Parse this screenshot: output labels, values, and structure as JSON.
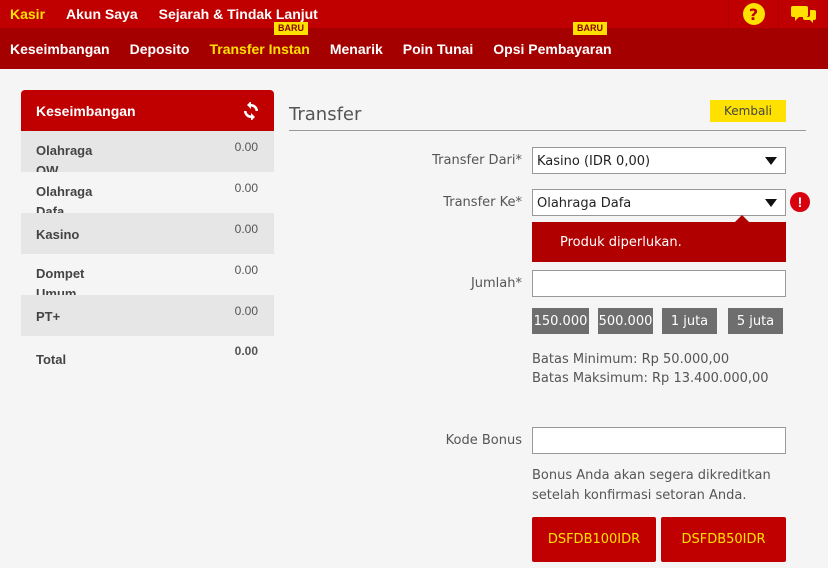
{
  "top_nav": [
    {
      "label": "Kasir",
      "active": true
    },
    {
      "label": "Akun Saya",
      "active": false
    },
    {
      "label": "Sejarah & Tindak Lanjut",
      "active": false
    }
  ],
  "top_icons": {
    "help": "?",
    "chat": "chat-icon"
  },
  "sub_nav": [
    {
      "label": "Keseimbangan"
    },
    {
      "label": "Deposito"
    },
    {
      "label": "Transfer Instan"
    },
    {
      "label": "Menarik"
    },
    {
      "label": "Poin Tunai"
    },
    {
      "label": "Opsi Pembayaran"
    }
  ],
  "badges": {
    "new_label_1": "BARU",
    "new_label_2": "BARU"
  },
  "sidebar": {
    "title": "Keseimbangan",
    "rows": [
      {
        "name": "Olahraga OW",
        "value": "0.00"
      },
      {
        "name": "Olahraga Dafa",
        "value": "0.00"
      },
      {
        "name": "Kasino",
        "value": "0.00"
      },
      {
        "name": "Dompet Umum",
        "value": "0.00"
      },
      {
        "name": "PT+",
        "value": "0.00"
      },
      {
        "name": "Total",
        "value": "0.00"
      }
    ]
  },
  "main": {
    "title": "Transfer",
    "back_label": "Kembali",
    "from_label": "Transfer Dari*",
    "from_value": "Kasino (IDR 0,00)",
    "to_label": "Transfer Ke*",
    "to_value": "Olahraga Dafa",
    "error_icon": "!",
    "error_message": "Produk diperlukan.",
    "amount_label": "Jumlah*",
    "amount_value": "",
    "quick_amounts": [
      "150.000",
      "500.000",
      "1 juta",
      "5 juta"
    ],
    "min_text": "Batas Minimum: Rp 50.000,00",
    "max_text": "Batas Maksimum: Rp 13.400.000,00",
    "bonus_label": "Kode Bonus",
    "bonus_value": "",
    "bonus_info_1": "Bonus Anda akan segera dikreditkan",
    "bonus_info_2": "setelah konfirmasi setoran Anda.",
    "bonus_codes": [
      "DSFDB100IDR",
      "DSFDB50IDR"
    ]
  },
  "colors": {
    "brand_red": "#c00000",
    "dark_red": "#a50000",
    "accent_yellow": "#ffe100"
  }
}
